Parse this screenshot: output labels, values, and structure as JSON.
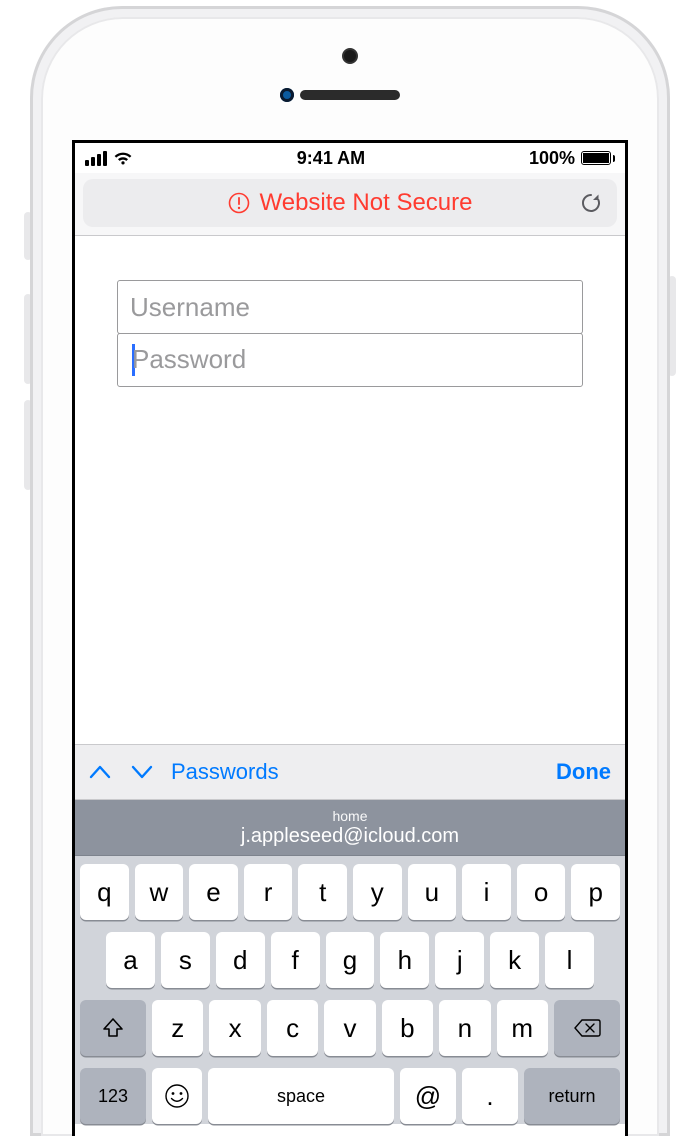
{
  "status_bar": {
    "time": "9:41 AM",
    "battery_pct": "100%"
  },
  "url_bar": {
    "warning_text": "Website Not Secure"
  },
  "form": {
    "username_placeholder": "Username",
    "password_placeholder": "Password"
  },
  "accessory_bar": {
    "passwords_label": "Passwords",
    "done_label": "Done"
  },
  "autofill_suggestion": {
    "tag": "home",
    "value": "j.appleseed@icloud.com"
  },
  "keyboard": {
    "row1": [
      "q",
      "w",
      "e",
      "r",
      "t",
      "y",
      "u",
      "i",
      "o",
      "p"
    ],
    "row2": [
      "a",
      "s",
      "d",
      "f",
      "g",
      "h",
      "j",
      "k",
      "l"
    ],
    "row3": [
      "z",
      "x",
      "c",
      "v",
      "b",
      "n",
      "m"
    ],
    "numbers_label": "123",
    "space_label": "space",
    "at_label": "@",
    "dot_label": ".",
    "return_label": "return"
  }
}
